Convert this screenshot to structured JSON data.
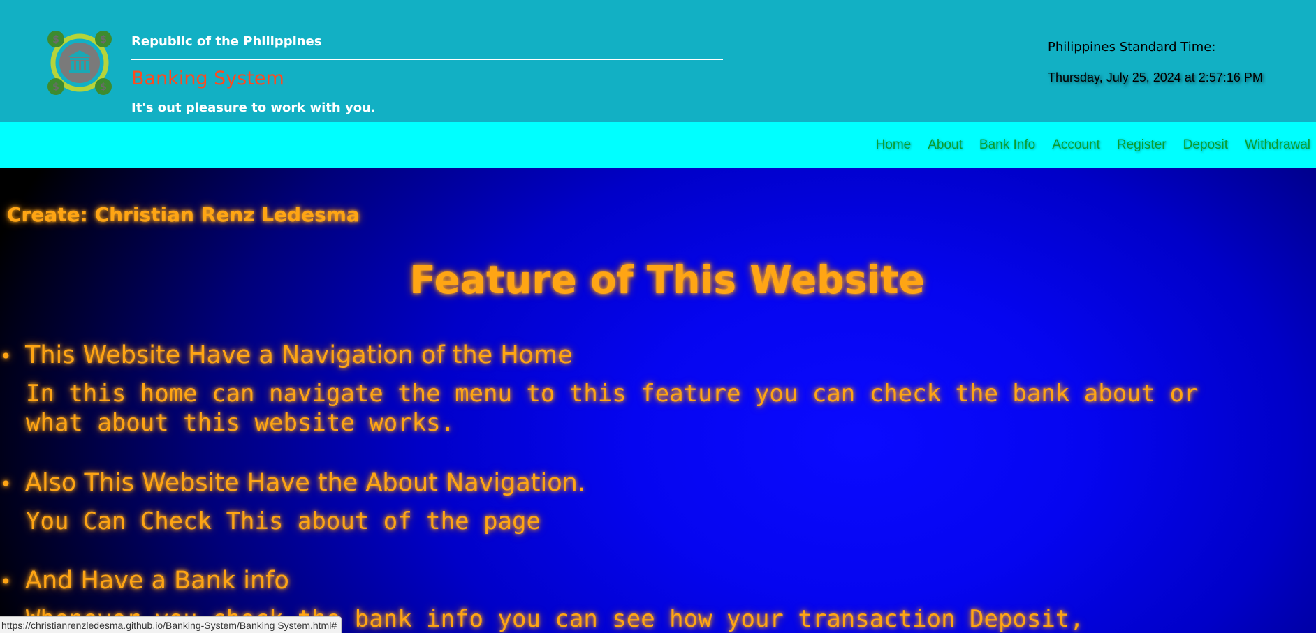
{
  "header": {
    "government": "Republic of the Philippines",
    "system_title": "Banking System",
    "tagline": "It's out pleasure to work with you.",
    "time_label": "Philippines Standard Time:",
    "time_value": "Thursday, July 25, 2024 at 2:57:16 PM",
    "logo_icon": "bank-logo-icon"
  },
  "nav": {
    "links": [
      "Home",
      "About",
      "Bank Info",
      "Account",
      "Register",
      "Deposit",
      "Withdrawal"
    ]
  },
  "main": {
    "creator": "Create: Christian Renz Ledesma",
    "feature_title": "Feature of This Website",
    "bullet": "•",
    "features": [
      {
        "heading": "This Website Have a Navigation of the Home",
        "description": "In this home can navigate the menu to this feature you can check the bank about or what about this website works."
      },
      {
        "heading": "Also This Website Have the About Navigation.",
        "description": "You Can Check This about of the page"
      },
      {
        "heading": "And Have a Bank info",
        "description": "Whenever you check the bank info you can see how your transaction Deposit,"
      }
    ]
  },
  "status_url": "https://christianrenzledesma.github.io/Banking-System/Banking System.html#",
  "colors": {
    "header_bg": "#12b0c4",
    "nav_bg": "#00ffff",
    "nav_link": "#0a9e2e",
    "title_orange": "#ff4a1f",
    "glow_text": "#ffa514",
    "main_blue": "#0505f0"
  }
}
